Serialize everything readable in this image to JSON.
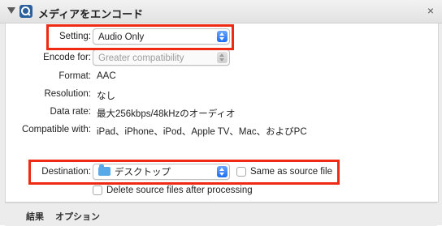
{
  "window": {
    "title": "メディアをエンコード",
    "close_label": "×"
  },
  "form": {
    "setting": {
      "label": "Setting:",
      "value": "Audio Only"
    },
    "encode_for": {
      "label": "Encode for:",
      "value": "Greater compatibility"
    },
    "format": {
      "label": "Format:",
      "value": "AAC"
    },
    "resolution": {
      "label": "Resolution:",
      "value": "なし"
    },
    "data_rate": {
      "label": "Data rate:",
      "value": "最大256kbps/48kHzのオーディオ"
    },
    "compatible": {
      "label": "Compatible with:",
      "value": "iPad、iPhone、iPod、Apple TV、Mac、およびPC"
    },
    "destination": {
      "label": "Destination:",
      "value": "デスクトップ"
    },
    "same_as_source": {
      "label": "Same as source file",
      "checked": false
    },
    "delete_source": {
      "label": "Delete source files after processing",
      "checked": false
    }
  },
  "tabs": [
    {
      "label": "結果"
    },
    {
      "label": "オプション"
    }
  ],
  "colors": {
    "highlight": "#ee2a14",
    "accent": "#1e6ef3",
    "folder": "#57a9e8"
  }
}
